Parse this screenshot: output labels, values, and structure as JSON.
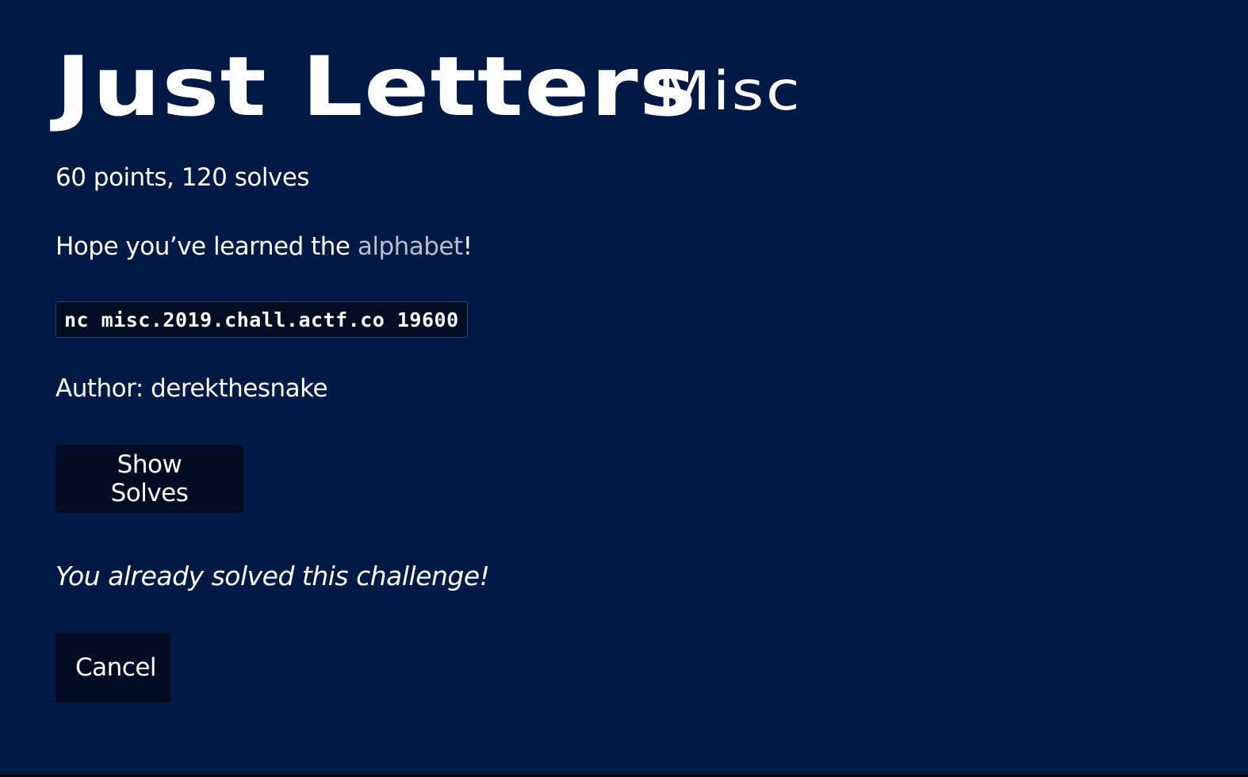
{
  "challenge": {
    "title": "Just Letters",
    "category": "Misc",
    "meta": "60 points, 120 solves",
    "description_prefix": "Hope you’ve learned the ",
    "description_link": "alphabet",
    "description_suffix": "!",
    "command": "nc misc.2019.chall.actf.co 19600",
    "author": "Author: derekthesnake"
  },
  "actions": {
    "show_solves_label": "Show Solves",
    "solved_message": "You already solved this challenge!",
    "cancel_label": "Cancel"
  },
  "colors": {
    "background": "#001945",
    "button_background": "#000c24",
    "link": "#b8bfcc",
    "text": "#ffffff"
  }
}
